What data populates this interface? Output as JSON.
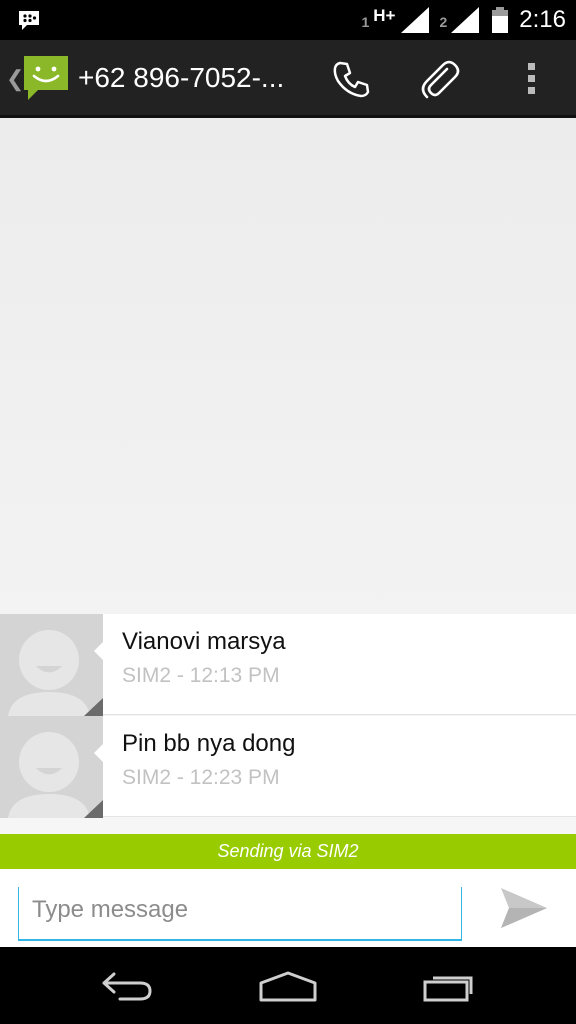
{
  "status_bar": {
    "sim1_label": "1",
    "network_type": "H+",
    "sim2_label": "2",
    "time": "2:16",
    "notification_icon": "bbm-icon"
  },
  "action_bar": {
    "title": "+62 896-7052-...",
    "app_icon": "messaging-smiley-icon",
    "actions": [
      "call-icon",
      "attach-icon",
      "overflow-menu-icon"
    ]
  },
  "messages": [
    {
      "text": "Vianovi marsya",
      "meta": "SIM2 - 12:13 PM"
    },
    {
      "text": "Pin bb nya dong",
      "meta": "SIM2 - 12:23 PM"
    }
  ],
  "sim_bar": {
    "label": "Sending via SIM2"
  },
  "compose": {
    "placeholder": "Type message",
    "value": ""
  },
  "colors": {
    "accent_green": "#99cc00",
    "input_underline": "#33b5e5",
    "action_bar_bg": "#222222"
  }
}
